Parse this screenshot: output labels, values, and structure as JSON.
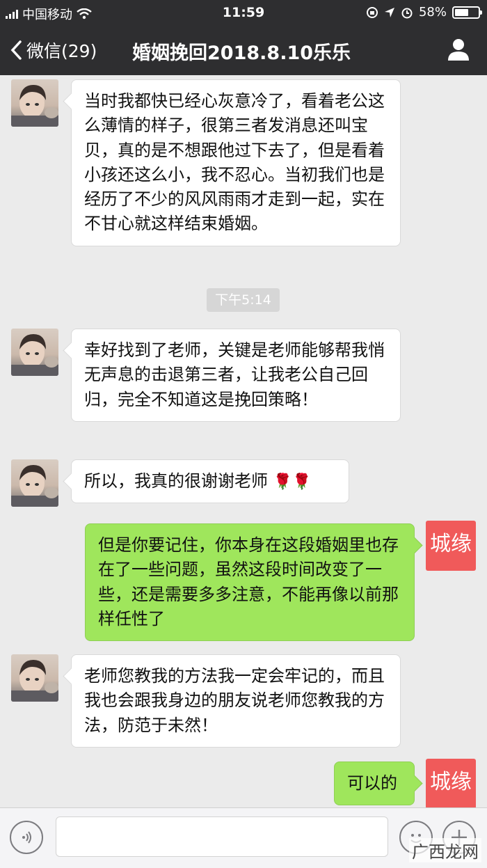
{
  "status_bar": {
    "carrier": "中国移动",
    "time": "11:59",
    "battery_percent": "58%",
    "battery_level": 0.58
  },
  "nav": {
    "back_label": "微信(29)",
    "title": "婚姻挽回2018.8.10乐乐"
  },
  "chat": {
    "timestamp": "下午5:14",
    "brand_avatar_text": "城缘",
    "messages": [
      {
        "from": "other",
        "text": "当时我都快已经心灰意冷了，看着老公这么薄情的样子，很第三者发消息还叫宝贝，真的是不想跟他过下去了，但是看着小孩还这么小，我不忍心。当初我们也是经历了不少的风风雨雨才走到一起，实在不甘心就这样结束婚姻。"
      },
      {
        "from": "other",
        "text": "幸好找到了老师，关键是老师能够帮我悄无声息的击退第三者，让我老公自己回归，完全不知道这是挽回策略！"
      },
      {
        "from": "other",
        "text": "所以，我真的很谢谢老师",
        "emoji": "🌹🌹"
      },
      {
        "from": "me",
        "text": "但是你要记住，你本身在这段婚姻里也存在了一些问题，虽然这段时间改变了一些，还是需要多多注意，不能再像以前那样任性了"
      },
      {
        "from": "other",
        "text": "老师您教我的方法我一定会牢记的，而且我也会跟我身边的朋友说老师您教我的方法，防范于未然！"
      },
      {
        "from": "me",
        "text": "可以的"
      }
    ]
  },
  "input_bar": {
    "placeholder": ""
  },
  "watermark": "广西龙网",
  "colors": {
    "header_bg": "#2e2e30",
    "chat_bg": "#ebebeb",
    "out_bubble": "#9fe65c",
    "brand_avatar": "#f05a5a"
  },
  "icons": [
    "back-chevron-icon",
    "profile-icon",
    "voice-icon",
    "emoji-icon",
    "plus-icon",
    "wifi-icon",
    "location-icon",
    "alarm-icon"
  ]
}
